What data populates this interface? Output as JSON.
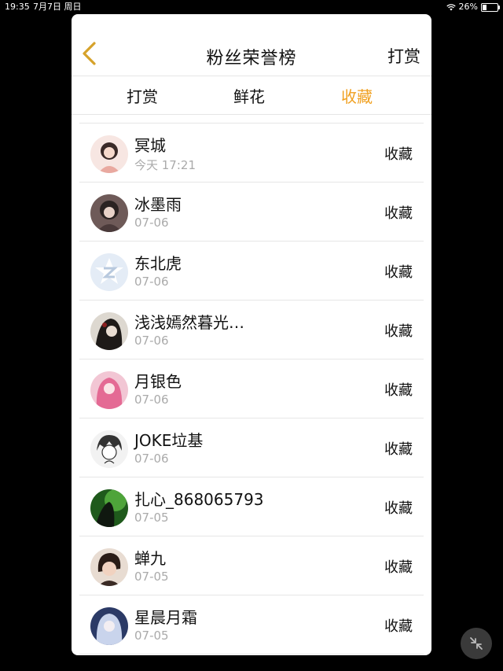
{
  "status_bar": {
    "time": "19:35",
    "date": "7月7日 周日",
    "battery_percent": "26%",
    "battery_level": 0.26
  },
  "nav": {
    "title": "粉丝荣誉榜",
    "action_label": "打赏"
  },
  "tabs": [
    {
      "label": "打赏",
      "active": false
    },
    {
      "label": "鲜花",
      "active": false
    },
    {
      "label": "收藏",
      "active": true
    }
  ],
  "rows": [
    {
      "name": "冥城",
      "time": "今天 17:21",
      "action": "收藏"
    },
    {
      "name": "冰墨雨",
      "time": "07-06",
      "action": "收藏"
    },
    {
      "name": "东北虎",
      "time": "07-06",
      "action": "收藏"
    },
    {
      "name": "浅浅嫣然暮光…",
      "time": "07-06",
      "action": "收藏"
    },
    {
      "name": "月银色",
      "time": "07-06",
      "action": "收藏"
    },
    {
      "name": "JOKE垃基",
      "time": "07-06",
      "action": "收藏"
    },
    {
      "name": "扎心_868065793",
      "time": "07-05",
      "action": "收藏"
    },
    {
      "name": "蝉九",
      "time": "07-05",
      "action": "收藏"
    },
    {
      "name": "星晨月霜",
      "time": "07-05",
      "action": "收藏"
    }
  ],
  "colors": {
    "accent": "#f0a020",
    "back_icon": "#d6a22a"
  }
}
